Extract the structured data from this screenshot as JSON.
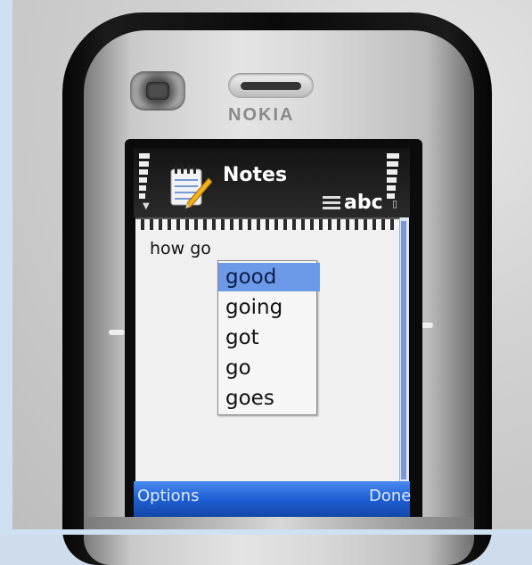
{
  "device": {
    "brand": "NOKIA"
  },
  "status": {
    "app_title": "Notes",
    "input_mode": "abc"
  },
  "note": {
    "text": "how go"
  },
  "suggestions": [
    {
      "label": "good",
      "selected": true
    },
    {
      "label": "going",
      "selected": false
    },
    {
      "label": "got",
      "selected": false
    },
    {
      "label": "go",
      "selected": false
    },
    {
      "label": "goes",
      "selected": false
    }
  ],
  "softkeys": {
    "left": "Options",
    "right": "Done"
  },
  "icons": [
    "notes-app-icon",
    "signal-strength-icon",
    "battery-icon",
    "input-mode-icon"
  ],
  "colors": {
    "selection": "#6d9ae8",
    "softkey_bar": "#1e5fd4",
    "status_bar": "#1a1a1a"
  }
}
